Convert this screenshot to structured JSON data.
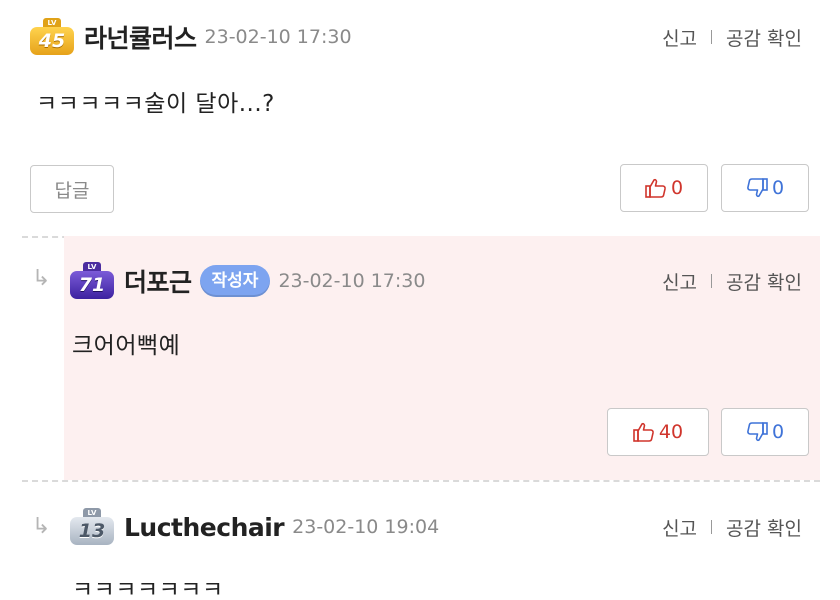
{
  "comments": [
    {
      "level": "45",
      "level_cap": "LV",
      "nickname": "라넌큘러스",
      "time": "23-02-10 17:30",
      "report_label": "신고",
      "empathy_label": "공감 확인",
      "body": "ㅋㅋㅋㅋㅋ술이 달아...?",
      "reply_label": "답글",
      "likes": "0",
      "dislikes": "0"
    },
    {
      "level": "71",
      "level_cap": "LV",
      "nickname": "더포근",
      "author_badge": "작성자",
      "time": "23-02-10 17:30",
      "report_label": "신고",
      "empathy_label": "공감 확인",
      "body": "크어어뻑예",
      "likes": "40",
      "dislikes": "0"
    },
    {
      "level": "13",
      "level_cap": "LV",
      "nickname": "Lucthechair",
      "time": "23-02-10 19:04",
      "report_label": "신고",
      "empathy_label": "공감 확인",
      "body": "ㅋㅋㅋㅋㅋㅋㅋ"
    }
  ],
  "reply_arrow_glyph": "↳",
  "colors": {
    "like": "#d0352c",
    "dislike": "#3f73d8",
    "author_badge": "#7da4f0",
    "reply_background": "#fdf0f0",
    "level_gold": "#f0b22a",
    "level_purple": "#5a3cc0",
    "level_silver": "#c5ced9"
  },
  "icons": [
    "thumbs-up-icon",
    "thumbs-down-icon",
    "level-badge-icon",
    "reply-arrow-icon"
  ]
}
